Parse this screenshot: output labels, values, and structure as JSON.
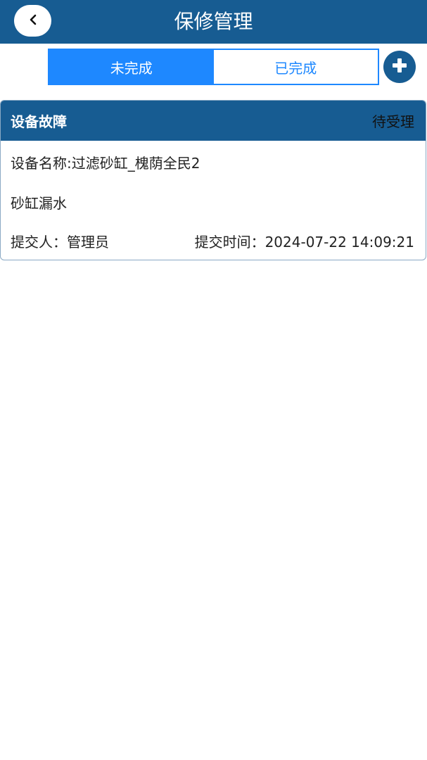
{
  "header": {
    "title": "保修管理",
    "back_icon": "chevron-left-icon"
  },
  "tabs": [
    {
      "label": "未完成",
      "active": true
    },
    {
      "label": "已完成",
      "active": false
    }
  ],
  "add_icon": "plus-icon",
  "colors": {
    "primary": "#175c92",
    "tab_accent": "#1e88ff"
  },
  "records": [
    {
      "type": "设备故障",
      "status": "待受理",
      "device_name": "设备名称:过滤砂缸_槐荫全民2",
      "description": "砂缸漏水",
      "submitter": "提交人：管理员",
      "submit_time": "提交时间：2024-07-22 14:09:21"
    }
  ]
}
